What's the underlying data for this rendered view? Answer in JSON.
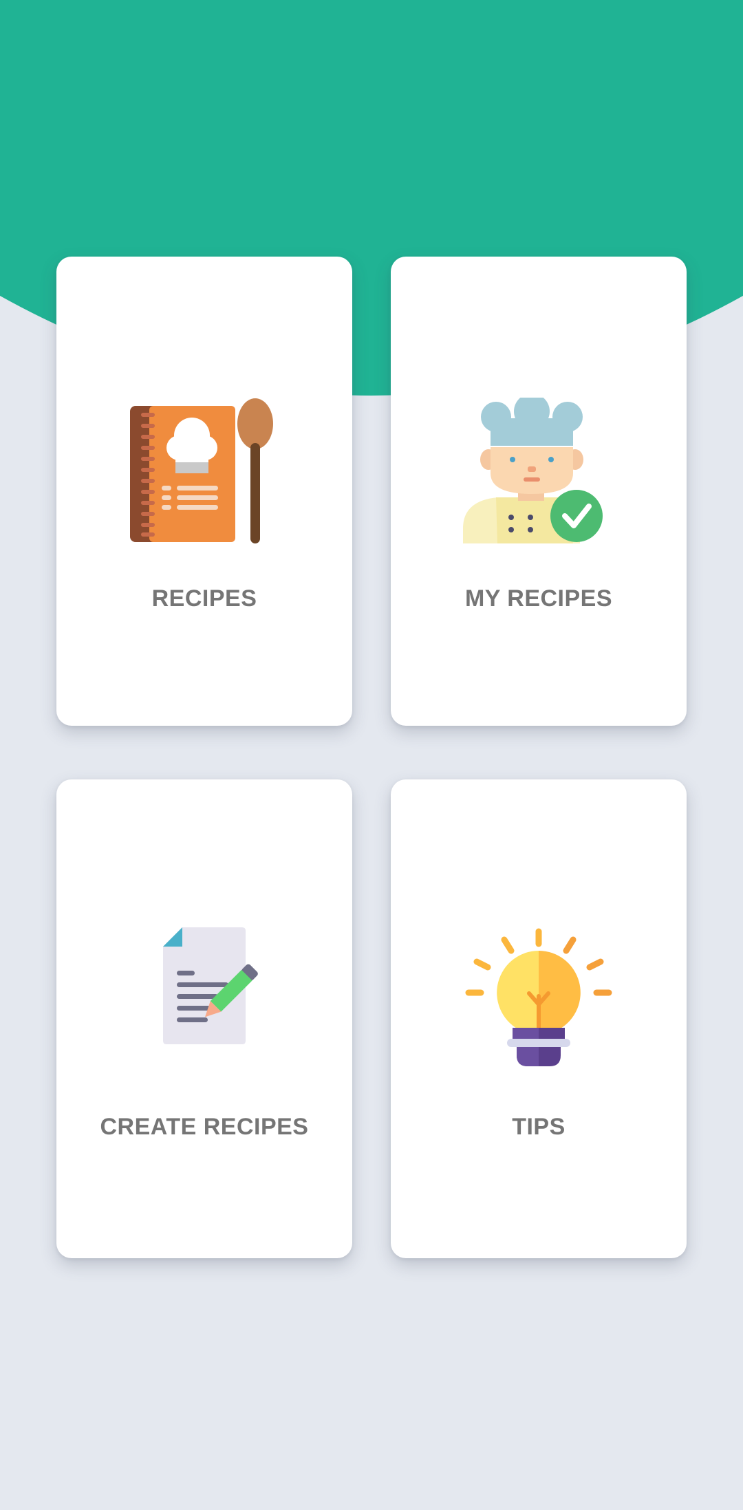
{
  "theme": {
    "header_color": "#20b394",
    "background": "#e4e8ef",
    "card_color": "#ffffff",
    "label_color": "#757575"
  },
  "menu": {
    "items": [
      {
        "id": "recipes",
        "label": "RECIPES",
        "icon": "recipe-book-icon"
      },
      {
        "id": "my-recipes",
        "label": "MY RECIPES",
        "icon": "chef-verified-icon"
      },
      {
        "id": "create-recipes",
        "label": "CREATE RECIPES",
        "icon": "document-pencil-icon"
      },
      {
        "id": "tips",
        "label": "TIPS",
        "icon": "lightbulb-icon"
      }
    ]
  }
}
